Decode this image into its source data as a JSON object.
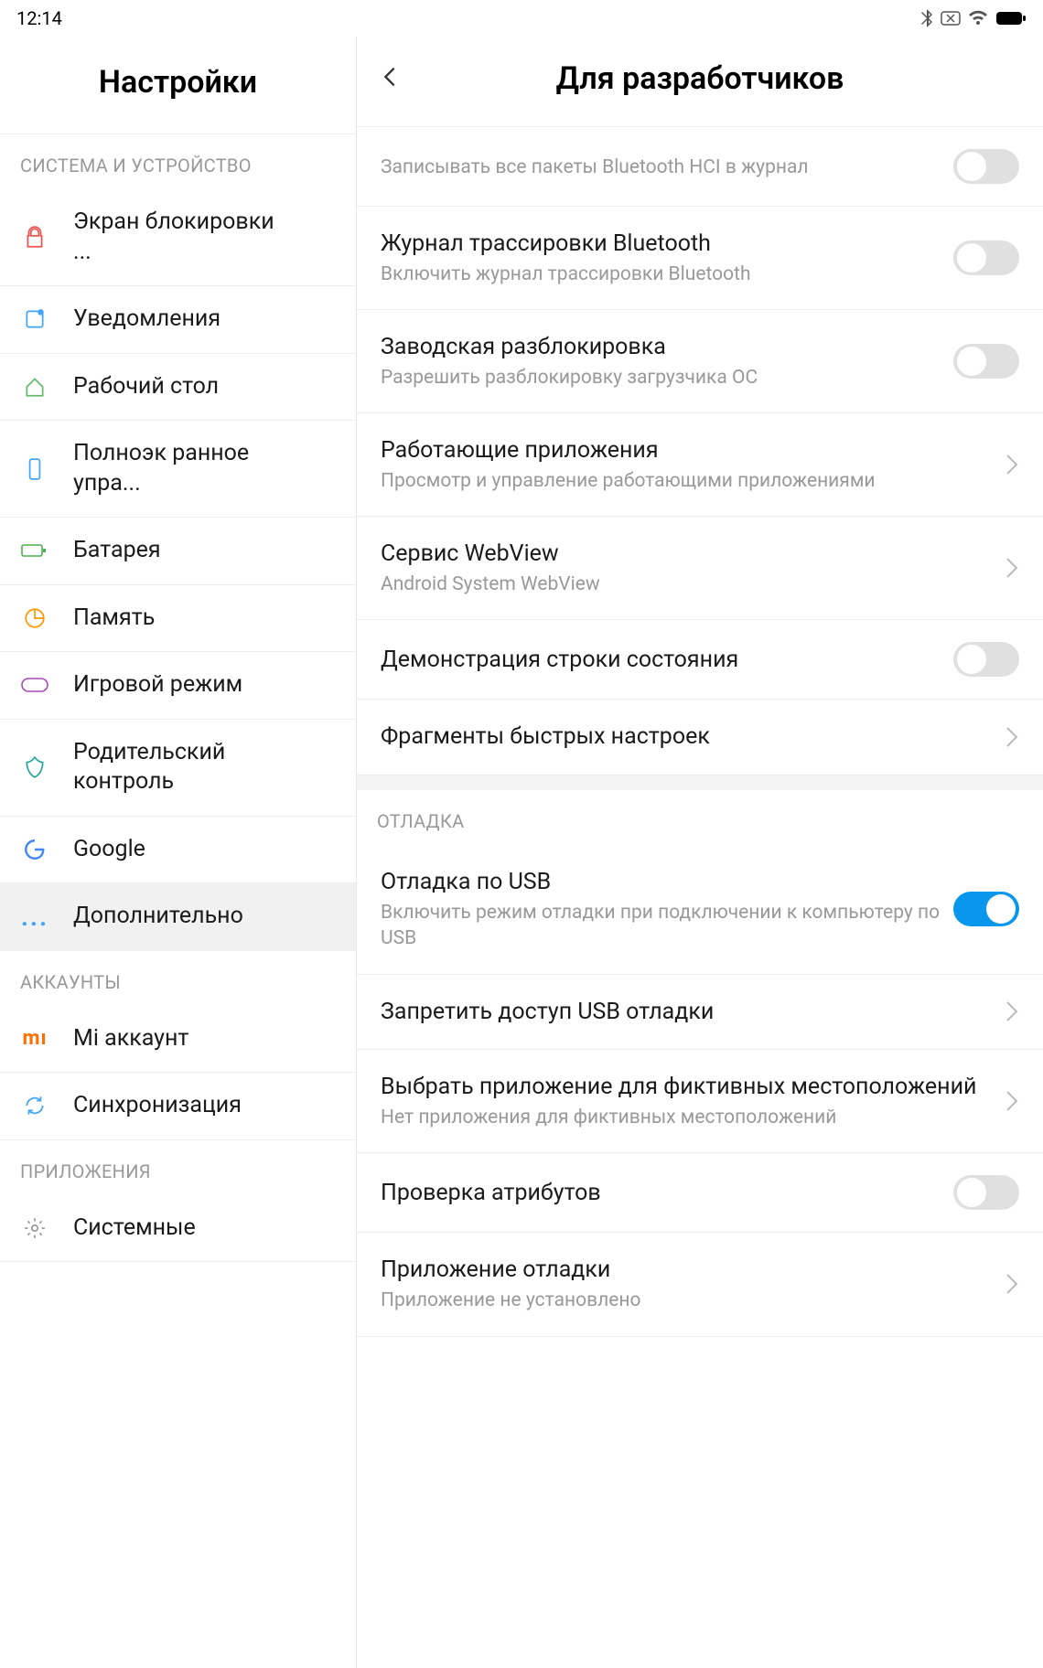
{
  "status": {
    "time": "12:14"
  },
  "sidebar": {
    "title": "Настройки",
    "sections": [
      {
        "header": "СИСТЕМА И УСТРОЙСТВО",
        "items": [
          {
            "label": "Экран блокировки ...",
            "icon": "lock",
            "color": "#ef5350"
          },
          {
            "label": "Уведомления",
            "icon": "notification",
            "color": "#42a5f5"
          },
          {
            "label": "Рабочий стол",
            "icon": "home",
            "color": "#66bb6a"
          },
          {
            "label": "Полноэк ранное упра...",
            "icon": "phone",
            "color": "#42a5f5"
          },
          {
            "label": "Батарея",
            "icon": "battery",
            "color": "#4caf50"
          },
          {
            "label": "Память",
            "icon": "storage",
            "color": "#ff9800"
          },
          {
            "label": "Игровой режим",
            "icon": "game",
            "color": "#ab47bc"
          },
          {
            "label": "Родительский контроль",
            "icon": "parental",
            "color": "#26a69a"
          },
          {
            "label": "Google",
            "icon": "google",
            "color": "#4285f4"
          },
          {
            "label": "Дополнительно",
            "icon": "more",
            "color": "#42a5f5",
            "selected": true
          }
        ]
      },
      {
        "header": "АККАУНТЫ",
        "items": [
          {
            "label": "Mi аккаунт",
            "icon": "mi",
            "color": "#ff6f00"
          },
          {
            "label": "Синхронизация",
            "icon": "sync",
            "color": "#42a5f5"
          }
        ]
      },
      {
        "header": "ПРИЛОЖЕНИЯ",
        "items": [
          {
            "label": "Системные",
            "icon": "system",
            "color": "#999"
          }
        ]
      }
    ]
  },
  "main": {
    "title": "Для разработчиков",
    "settings": [
      {
        "title": "Записывать все пакеты Bluetooth HCI в журнал",
        "type": "toggle",
        "on": false,
        "subtitleColor": "#999",
        "asSubtitle": true
      },
      {
        "title": "Журнал трассировки Bluetooth",
        "subtitle": "Включить журнал трассировки Bluetooth",
        "type": "toggle",
        "on": false
      },
      {
        "title": "Заводская разблокировка",
        "subtitle": "Разрешить разблокировку загрузчика ОС",
        "type": "toggle",
        "on": false
      },
      {
        "title": "Работающие приложения",
        "subtitle": "Просмотр и управление работающими приложениями",
        "type": "link"
      },
      {
        "title": "Сервис WebView",
        "subtitle": "Android System WebView",
        "type": "link"
      },
      {
        "title": "Демонстрация строки состояния",
        "type": "toggle",
        "on": false
      },
      {
        "title": "Фрагменты быстрых настроек",
        "type": "link"
      },
      {
        "type": "section",
        "header": "ОТЛАДКА"
      },
      {
        "title": "Отладка по USB",
        "subtitle": "Включить режим отладки при подключении к компьютеру по USB",
        "type": "toggle",
        "on": true
      },
      {
        "title": "Запретить доступ USB отладки",
        "type": "link"
      },
      {
        "title": "Выбрать приложение для фиктивных местоположений",
        "subtitle": "Нет приложения для фиктивных местоположений",
        "type": "link"
      },
      {
        "title": "Проверка атрибутов",
        "type": "toggle",
        "on": false
      },
      {
        "title": "Приложение отладки",
        "subtitle": "Приложение не установлено",
        "type": "link"
      }
    ]
  }
}
